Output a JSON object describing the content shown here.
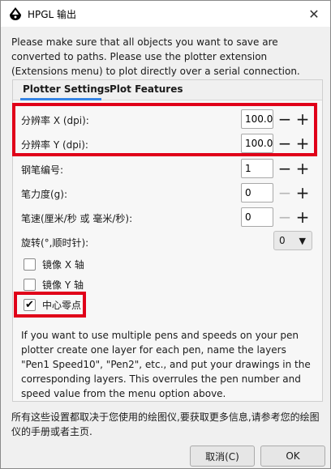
{
  "window": {
    "title": "HPGL 输出",
    "close_glyph": "✕"
  },
  "intro_text": "Please make sure that all objects you want to save are converted to paths. Please use the plotter extension (Extensions menu) to plot directly over a serial connection.",
  "tabs": [
    {
      "label": "Plotter Settings",
      "active": true
    },
    {
      "label": "Plot Features",
      "active": false
    }
  ],
  "fields": {
    "resolution_x": {
      "label": "分辨率 X (dpi):",
      "value": "100.0"
    },
    "resolution_y": {
      "label": "分辨率 Y (dpi):",
      "value": "100.0"
    },
    "pen_number": {
      "label": "钢笔编号:",
      "value": "1"
    },
    "pen_force": {
      "label": "笔力度(g):",
      "value": "0"
    },
    "pen_speed": {
      "label": "笔速(厘米/秒 或 毫米/秒):",
      "value": "0"
    },
    "rotation": {
      "label": "旋转(°,顺时针):",
      "value": "0"
    }
  },
  "spin_glyphs": {
    "minus": "−",
    "plus": "+"
  },
  "combo_arrow": "▼",
  "checkboxes": {
    "mirror_x": {
      "label": "镜像 X 轴",
      "checked": false
    },
    "mirror_y": {
      "label": "镜像 Y 轴",
      "checked": false
    },
    "center_zero": {
      "label": "中心零点",
      "checked": true,
      "mark": "✔"
    }
  },
  "pen_note": "If you want to use multiple pens and speeds on your pen plotter create one layer for each pen, name the layers \"Pen1 Speed10\", \"Pen2\", etc., and put your drawings in the corresponding layers. This overrules the pen number and speed value from the menu option above.",
  "footer_note": "所有这些设置都取决于您使用的绘图仪,要获取更多信息,请参考您的绘图仪的手册或者主页.",
  "buttons": {
    "cancel": "取消(C)",
    "ok": "OK"
  },
  "colors": {
    "highlight_box": "#e00019",
    "tab_accent": "#3584e4"
  }
}
